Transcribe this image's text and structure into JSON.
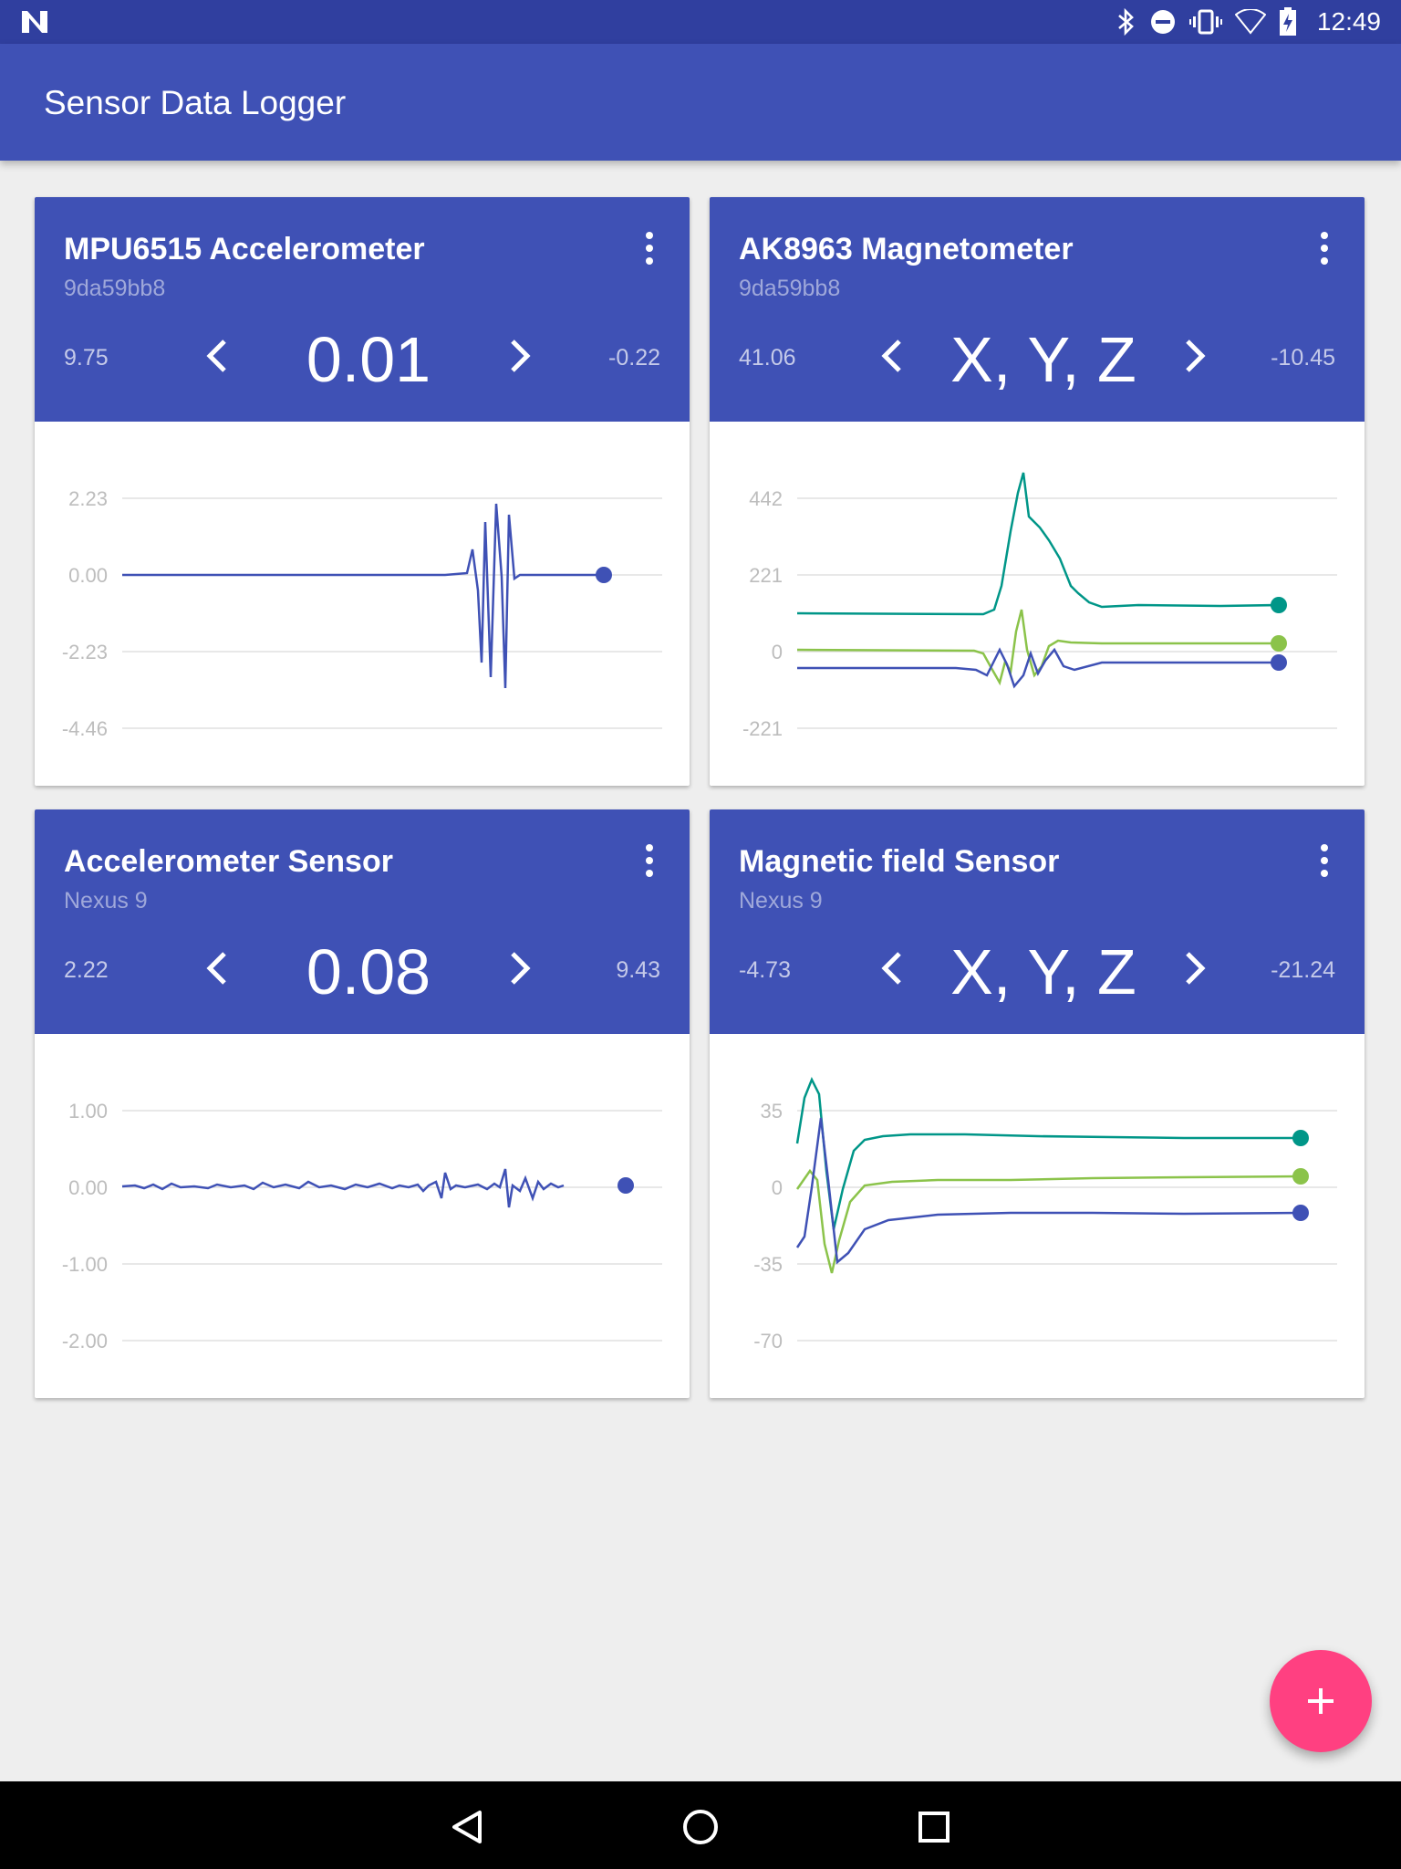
{
  "status_bar": {
    "time": "12:49"
  },
  "app_bar": {
    "title": "Sensor Data Logger"
  },
  "cards": [
    {
      "title": "MPU6515 Accelerometer",
      "subtitle": "9da59bb8",
      "min": "9.75",
      "value": "0.01",
      "max": "-0.22",
      "axis_labels": [
        "2.23",
        "0.00",
        "-2.23",
        "-4.46"
      ]
    },
    {
      "title": "AK8963 Magnetometer",
      "subtitle": "9da59bb8",
      "min": "41.06",
      "value": "X, Y, Z",
      "max": "-10.45",
      "axis_labels": [
        "442",
        "221",
        "0",
        "-221"
      ]
    },
    {
      "title": "Accelerometer Sensor",
      "subtitle": "Nexus 9",
      "min": "2.22",
      "value": "0.08",
      "max": "9.43",
      "axis_labels": [
        "1.00",
        "0.00",
        "-1.00",
        "-2.00"
      ]
    },
    {
      "title": "Magnetic field Sensor",
      "subtitle": "Nexus 9",
      "min": "-4.73",
      "value": "X, Y, Z",
      "max": "-21.24",
      "axis_labels": [
        "35",
        "0",
        "-35",
        "-70"
      ]
    }
  ],
  "colors": {
    "primary": "#3f51b5",
    "primary_dark": "#303f9f",
    "accent": "#ff4081",
    "series_x": "#3f51b5",
    "series_y": "#8bc34a",
    "series_z": "#009688"
  },
  "icons": {
    "fab": "add-icon",
    "menu": "more-vert-icon",
    "prev": "chevron-left-icon",
    "next": "chevron-right-icon"
  }
}
